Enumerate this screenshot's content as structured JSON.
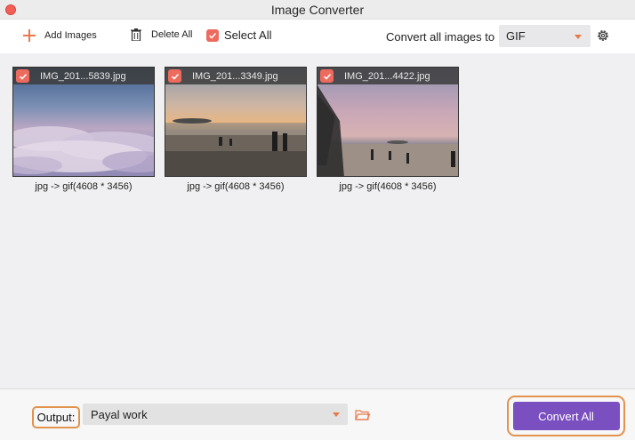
{
  "window": {
    "title": "Image Converter"
  },
  "toolbar": {
    "add_label": "Add Images",
    "delete_label": "Delete All",
    "select_all_label": "Select All",
    "convert_to_label": "Convert all images to",
    "format_value": "GIF"
  },
  "images": [
    {
      "name": "IMG_201...5839.jpg",
      "caption": "jpg -> gif(4608 * 3456)",
      "checked": true
    },
    {
      "name": "IMG_201...3349.jpg",
      "caption": "jpg -> gif(4608 * 3456)",
      "checked": true
    },
    {
      "name": "IMG_201...4422.jpg",
      "caption": "jpg -> gif(4608 * 3456)",
      "checked": true
    }
  ],
  "footer": {
    "output_label": "Output:",
    "output_value": "Payal work",
    "convert_all_label": "Convert All"
  },
  "colors": {
    "accent_orange": "#e8794a",
    "checkbox_red": "#ec6a5e",
    "convert_purple": "#7a4fbf",
    "highlight_orange": "#e2924c"
  }
}
